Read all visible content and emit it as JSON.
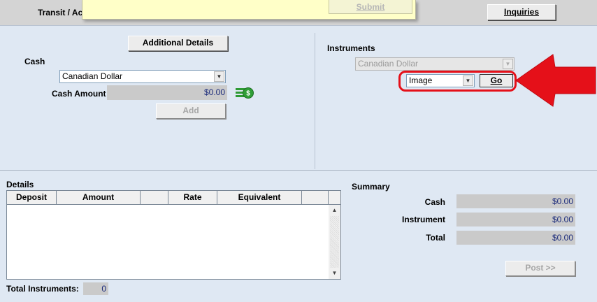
{
  "topbar": {
    "partial_label": "Transit / Ac",
    "submit_label": "Submit",
    "inquiries_label": "Inquiries"
  },
  "cash": {
    "additional_details_label": "Additional Details",
    "section_label": "Cash",
    "currency_selected": "Canadian Dollar",
    "amount_label": "Cash Amount",
    "amount_value": "$0.00",
    "add_label": "Add"
  },
  "instruments": {
    "section_label": "Instruments",
    "currency_selected": "Canadian Dollar",
    "type_selected": "Image",
    "go_label": "Go"
  },
  "details": {
    "section_label": "Details",
    "columns": [
      "Deposit",
      "Amount",
      "",
      "Rate",
      "Equivalent",
      ""
    ],
    "total_label": "Total Instruments:",
    "total_value": "0"
  },
  "summary": {
    "section_label": "Summary",
    "cash_label": "Cash",
    "cash_value": "$0.00",
    "instrument_label": "Instrument",
    "instrument_value": "$0.00",
    "total_label": "Total",
    "total_value": "$0.00",
    "post_label": "Post >>"
  },
  "icons": {
    "money": "money-icon",
    "annotation_arrow": "red-arrow-icon",
    "dropdown_arrow": "chevron-down-icon"
  },
  "colors": {
    "background": "#dfe8f3",
    "annotation_red": "#e51019",
    "readonly_field": "#cacaca",
    "value_text": "#1a2a7a"
  }
}
